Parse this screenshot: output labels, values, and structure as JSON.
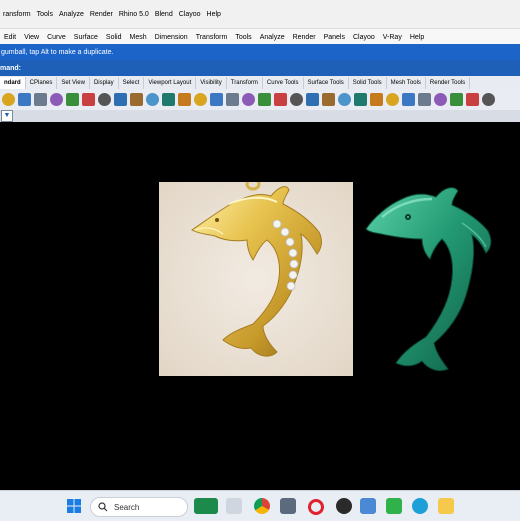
{
  "app": {
    "top_menu": [
      "ransform",
      "Tools",
      "Analyze",
      "Render",
      "Rhino 5.0",
      "Blend",
      "Clayoo",
      "Help"
    ],
    "main_menu": [
      "Edit",
      "View",
      "Curve",
      "Surface",
      "Solid",
      "Mesh",
      "Dimension",
      "Transform",
      "Tools",
      "Analyze",
      "Render",
      "Panels",
      "Clayoo",
      "V-Ray",
      "Help"
    ]
  },
  "status": {
    "hint": "gumball, tap Alt to make a duplicate.",
    "command_prompt": "mand:"
  },
  "toolbar_tabs": [
    "ndard",
    "CPlanes",
    "Set View",
    "Display",
    "Select",
    "Viewport Layout",
    "Visibility",
    "Transform",
    "Curve Tools",
    "Surface Tools",
    "Solid Tools",
    "Mesh Tools",
    "Render Tools"
  ],
  "toolbar_icons": [
    "open-folder-icon",
    "save-icon",
    "print-icon",
    "import-icon",
    "cut-icon",
    "copy-icon",
    "paste-icon",
    "undo-icon",
    "pan-hand-icon",
    "move-icon",
    "zoom-icon",
    "zoom-extents-icon",
    "zoom-window-icon",
    "zoom-selected-icon",
    "rotate-view-icon",
    "grid-icon",
    "perspective-icon",
    "ortho-icon",
    "snap-icon",
    "hide-icon",
    "lock-icon",
    "light-icon",
    "color-icon",
    "display-mode-icon",
    "rendered-icon",
    "shaded-icon",
    "sphere-icon",
    "material-icon",
    "settings-gear-icon",
    "help-icon",
    "extra-icon"
  ],
  "viewport": {
    "background": "#000000",
    "reference_image": "gold dolphin pendant photo",
    "model": "green dolphin 3D model"
  },
  "taskbar": {
    "search_label": "Search",
    "apps": [
      "windows-start-icon",
      "search-icon",
      "widgets-icon",
      "chrome-icon",
      "files-icon",
      "opera-icon",
      "media-icon",
      "tools-icon",
      "game-icon",
      "edge-icon",
      "notes-icon"
    ]
  },
  "colors": {
    "hint_bar": "#1d64c9",
    "command_bar": "#1e5fb8",
    "model_green": "#1f8f6e",
    "gold": "#d8b445"
  }
}
